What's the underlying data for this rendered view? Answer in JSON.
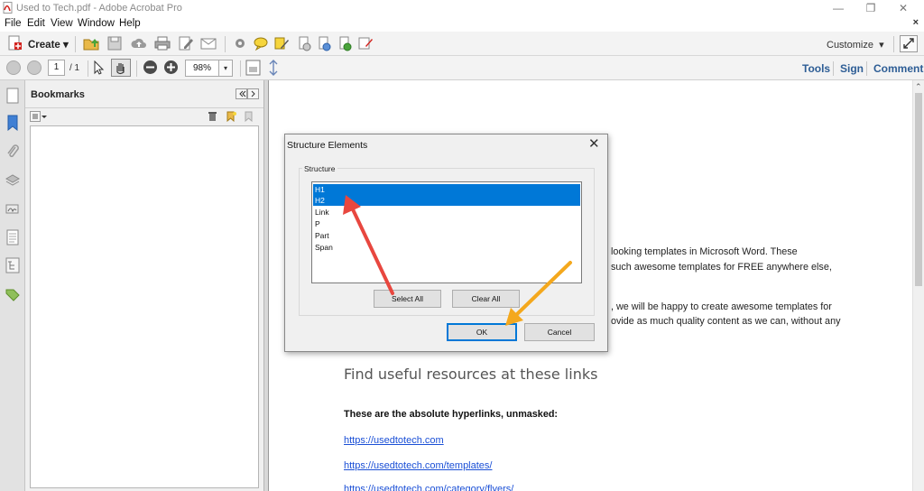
{
  "window": {
    "title": "Used to Tech.pdf - Adobe Acrobat Pro",
    "minimize_glyph": "—",
    "restore_glyph": "❐",
    "close_glyph": "✕"
  },
  "menu": {
    "items": [
      "File",
      "Edit",
      "View",
      "Window",
      "Help"
    ],
    "close_doc_glyph": "×"
  },
  "toolbar1": {
    "create_label": "Create",
    "customize_label": "Customize"
  },
  "toolbar2": {
    "page_current": "1",
    "page_total": "/ 1",
    "zoom": "98%",
    "tools_label": "Tools",
    "sign_label": "Sign",
    "comment_label": "Comment"
  },
  "bookmarks": {
    "title": "Bookmarks"
  },
  "document": {
    "para1_line1": "looking templates in Microsoft Word. These",
    "para1_line2": "such awesome templates for FREE anywhere else,",
    "para2_line1": ", we will be happy to create awesome templates for",
    "para2_line2": "ovide as much quality content as we can, without any",
    "heading": "Find useful resources at these links",
    "bold_line": "These are the absolute hyperlinks, unmasked:",
    "links": [
      "https://usedtotech.com",
      "https://usedtotech.com/templates/",
      "https://usedtotech.com/category/flyers/"
    ]
  },
  "dialog": {
    "title": "Structure Elements",
    "group_label": "Structure",
    "items": [
      "H1",
      "H2",
      "Link",
      "P",
      "Part",
      "Span"
    ],
    "selected": [
      "H1",
      "H2"
    ],
    "select_all_label": "Select All",
    "clear_all_label": "Clear All",
    "ok_label": "OK",
    "cancel_label": "Cancel",
    "close_glyph": "✕"
  },
  "colors": {
    "selection": "#0078d7",
    "link": "#1a4fd6",
    "panel_link": "#2d5d95",
    "arrow_red": "#e8473f",
    "arrow_yellow": "#f4a81d"
  }
}
